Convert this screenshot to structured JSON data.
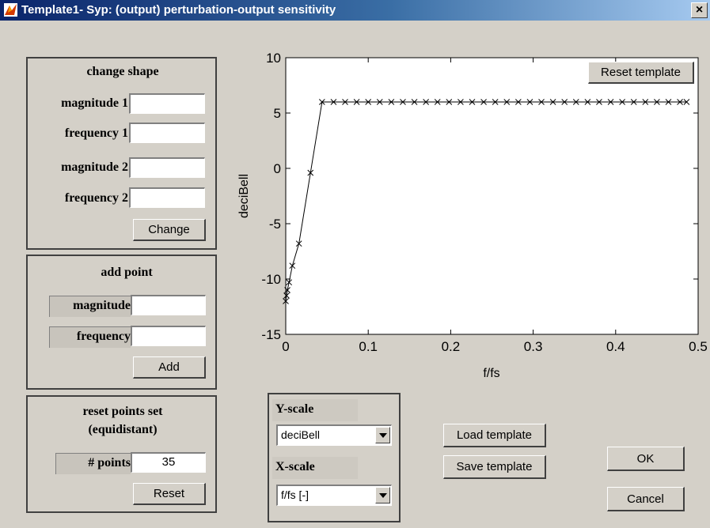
{
  "window": {
    "title": "Template1- Syp: (output) perturbation-output sensitivity",
    "close_glyph": "×"
  },
  "change_shape": {
    "title": "change shape",
    "magnitude1_label": "magnitude 1",
    "frequency1_label": "frequency 1",
    "magnitude2_label": "magnitude 2",
    "frequency2_label": "frequency 2",
    "magnitude1_value": "",
    "frequency1_value": "",
    "magnitude2_value": "",
    "frequency2_value": "",
    "button_label": "Change"
  },
  "add_point": {
    "title": "add point",
    "magnitude_label": "magnitude",
    "frequency_label": "frequency",
    "magnitude_value": "",
    "frequency_value": "",
    "button_label": "Add"
  },
  "reset_points": {
    "title_line1": "reset points set",
    "title_line2": "(equidistant)",
    "points_label": "# points",
    "points_value": "35",
    "button_label": "Reset"
  },
  "scales": {
    "y_label": "Y-scale",
    "y_selected": "deciBell",
    "x_label": "X-scale",
    "x_selected": "f/fs [-]"
  },
  "buttons": {
    "reset_template": "Reset template",
    "load_template": "Load template",
    "save_template": "Save template",
    "ok": "OK",
    "cancel": "Cancel"
  },
  "chart_data": {
    "type": "line",
    "xlabel": "f/fs",
    "ylabel": "deciBell",
    "xlim": [
      0,
      0.5
    ],
    "ylim": [
      -15,
      10
    ],
    "xticks": [
      "0",
      "0.1",
      "0.2",
      "0.3",
      "0.4",
      "0.5"
    ],
    "yticks": [
      "-15",
      "-10",
      "-5",
      "0",
      "5",
      "10"
    ],
    "grid": false,
    "marker": "x",
    "x": [
      0.0,
      0.001,
      0.002,
      0.004,
      0.008,
      0.016,
      0.03,
      0.044,
      0.058,
      0.072,
      0.086,
      0.1,
      0.114,
      0.128,
      0.142,
      0.156,
      0.17,
      0.184,
      0.198,
      0.212,
      0.226,
      0.24,
      0.254,
      0.268,
      0.282,
      0.296,
      0.31,
      0.324,
      0.338,
      0.352,
      0.366,
      0.38,
      0.394,
      0.408,
      0.422,
      0.436,
      0.45,
      0.464,
      0.478,
      0.486
    ],
    "y": [
      -12,
      -11.5,
      -11,
      -10.3,
      -8.8,
      -6.8,
      -0.4,
      6,
      6,
      6,
      6,
      6,
      6,
      6,
      6,
      6,
      6,
      6,
      6,
      6,
      6,
      6,
      6,
      6,
      6,
      6,
      6,
      6,
      6,
      6,
      6,
      6,
      6,
      6,
      6,
      6,
      6,
      6,
      6,
      6
    ]
  }
}
